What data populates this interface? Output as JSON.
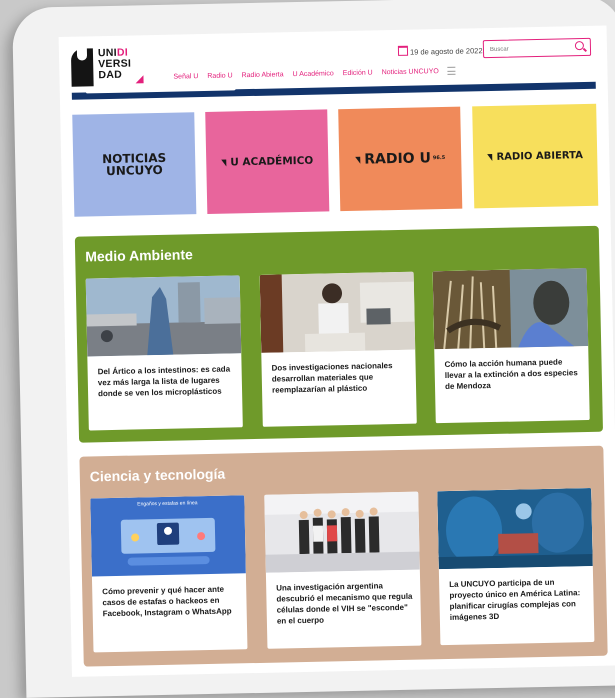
{
  "header": {
    "logo_lines": [
      "UNI",
      "VERSI",
      "DAD"
    ],
    "date": "19 de agosto de 2022",
    "search_placeholder": "Buscar",
    "nav": [
      "Señal U",
      "Radio U",
      "Radio Abierta",
      "U Académico",
      "Edición U",
      "Noticias UNCUYO"
    ]
  },
  "brands": [
    {
      "line1": "NOTICIAS",
      "line2": "UNCUYO",
      "color": "#9fb4e6"
    },
    {
      "label": "U ACADÉMICO",
      "color": "#e8659c"
    },
    {
      "label": "RADIO U",
      "sup": "96.5",
      "color": "#f08a5a"
    },
    {
      "label": "RADIO ABIERTA",
      "color": "#f7df5c"
    }
  ],
  "sections": [
    {
      "title": "Medio Ambiente",
      "color": "#6f9a2a",
      "cards": [
        {
          "title": "Del Ártico a los intestinos: es cada vez más larga la lista de lugares donde se ven los microplásticos"
        },
        {
          "title": "Dos investigaciones nacionales desarrollan materiales que reemplazarían al plástico"
        },
        {
          "title": "Cómo la acción humana puede llevar a la extinción a dos especies de Mendoza"
        }
      ]
    },
    {
      "title": "Ciencia y tecnología",
      "color": "#d2ae94",
      "cards": [
        {
          "title": "Cómo prevenir y qué hacer ante casos de estafas o hackeos en Facebook, Instagram o WhatsApp",
          "image_text": "Engaños y estafas en línea"
        },
        {
          "title": "Una investigación argentina descubrió el mecanismo que regula células donde el VIH se \"esconde\" en el cuerpo"
        },
        {
          "title": "La UNCUYO participa de un proyecto único en América Latina: planificar cirugías complejas con imágenes 3D"
        }
      ]
    }
  ]
}
